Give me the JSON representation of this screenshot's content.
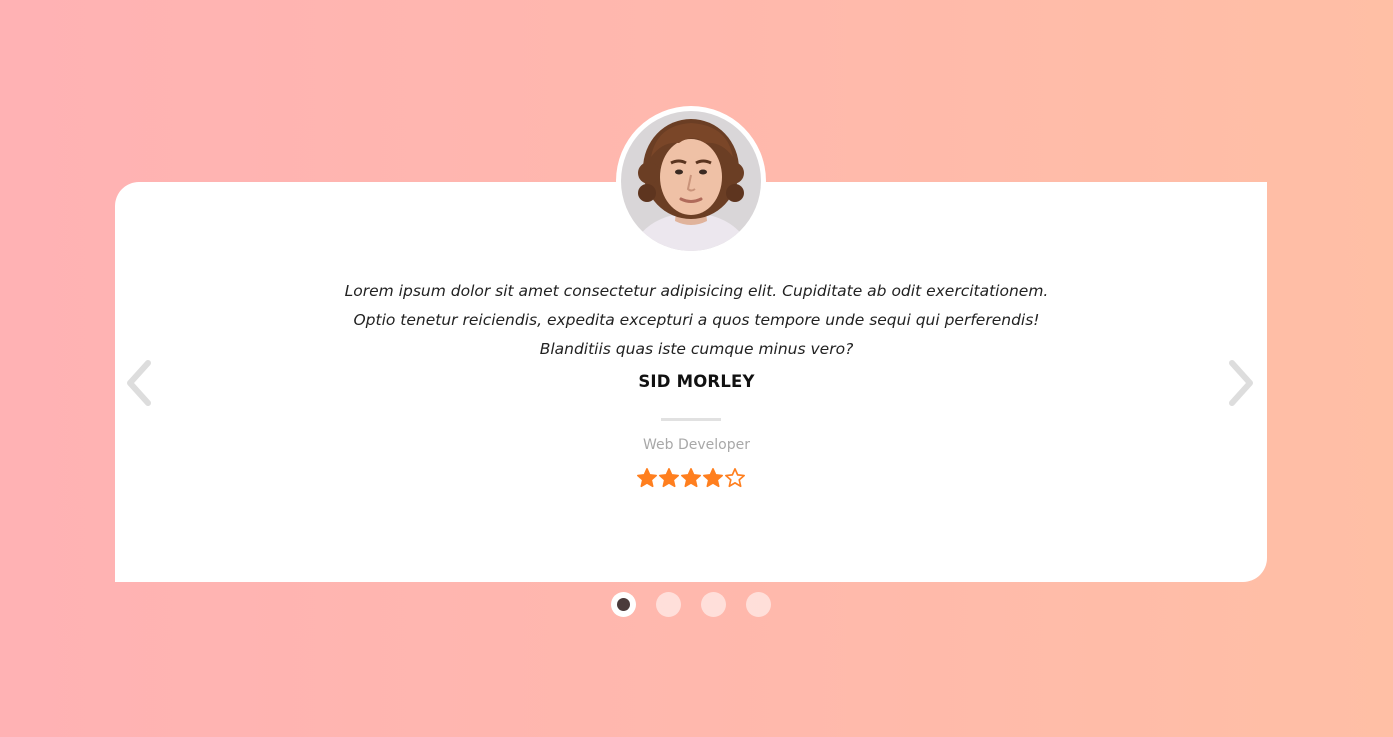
{
  "testimonial": {
    "quote_lines": [
      "Lorem ipsum dolor sit amet consectetur adipisicing elit. Cupiditate ab odit exercitationem.",
      "Optio tenetur reiciendis, expedita excepturi a quos tempore unde sequi qui perferendis!",
      "Blanditiis quas iste cumque minus vero?"
    ],
    "name": "SID MORLEY",
    "role": "Web Developer",
    "rating": 4,
    "rating_max": 5
  },
  "carousel": {
    "slide_count": 4,
    "active_index": 0,
    "prev_icon": "chevron-left-icon",
    "next_icon": "chevron-right-icon"
  },
  "colors": {
    "background_start": "#ffb2b4",
    "background_end": "#ffbfa5",
    "star": "#ff7f1f",
    "card": "#ffffff"
  }
}
